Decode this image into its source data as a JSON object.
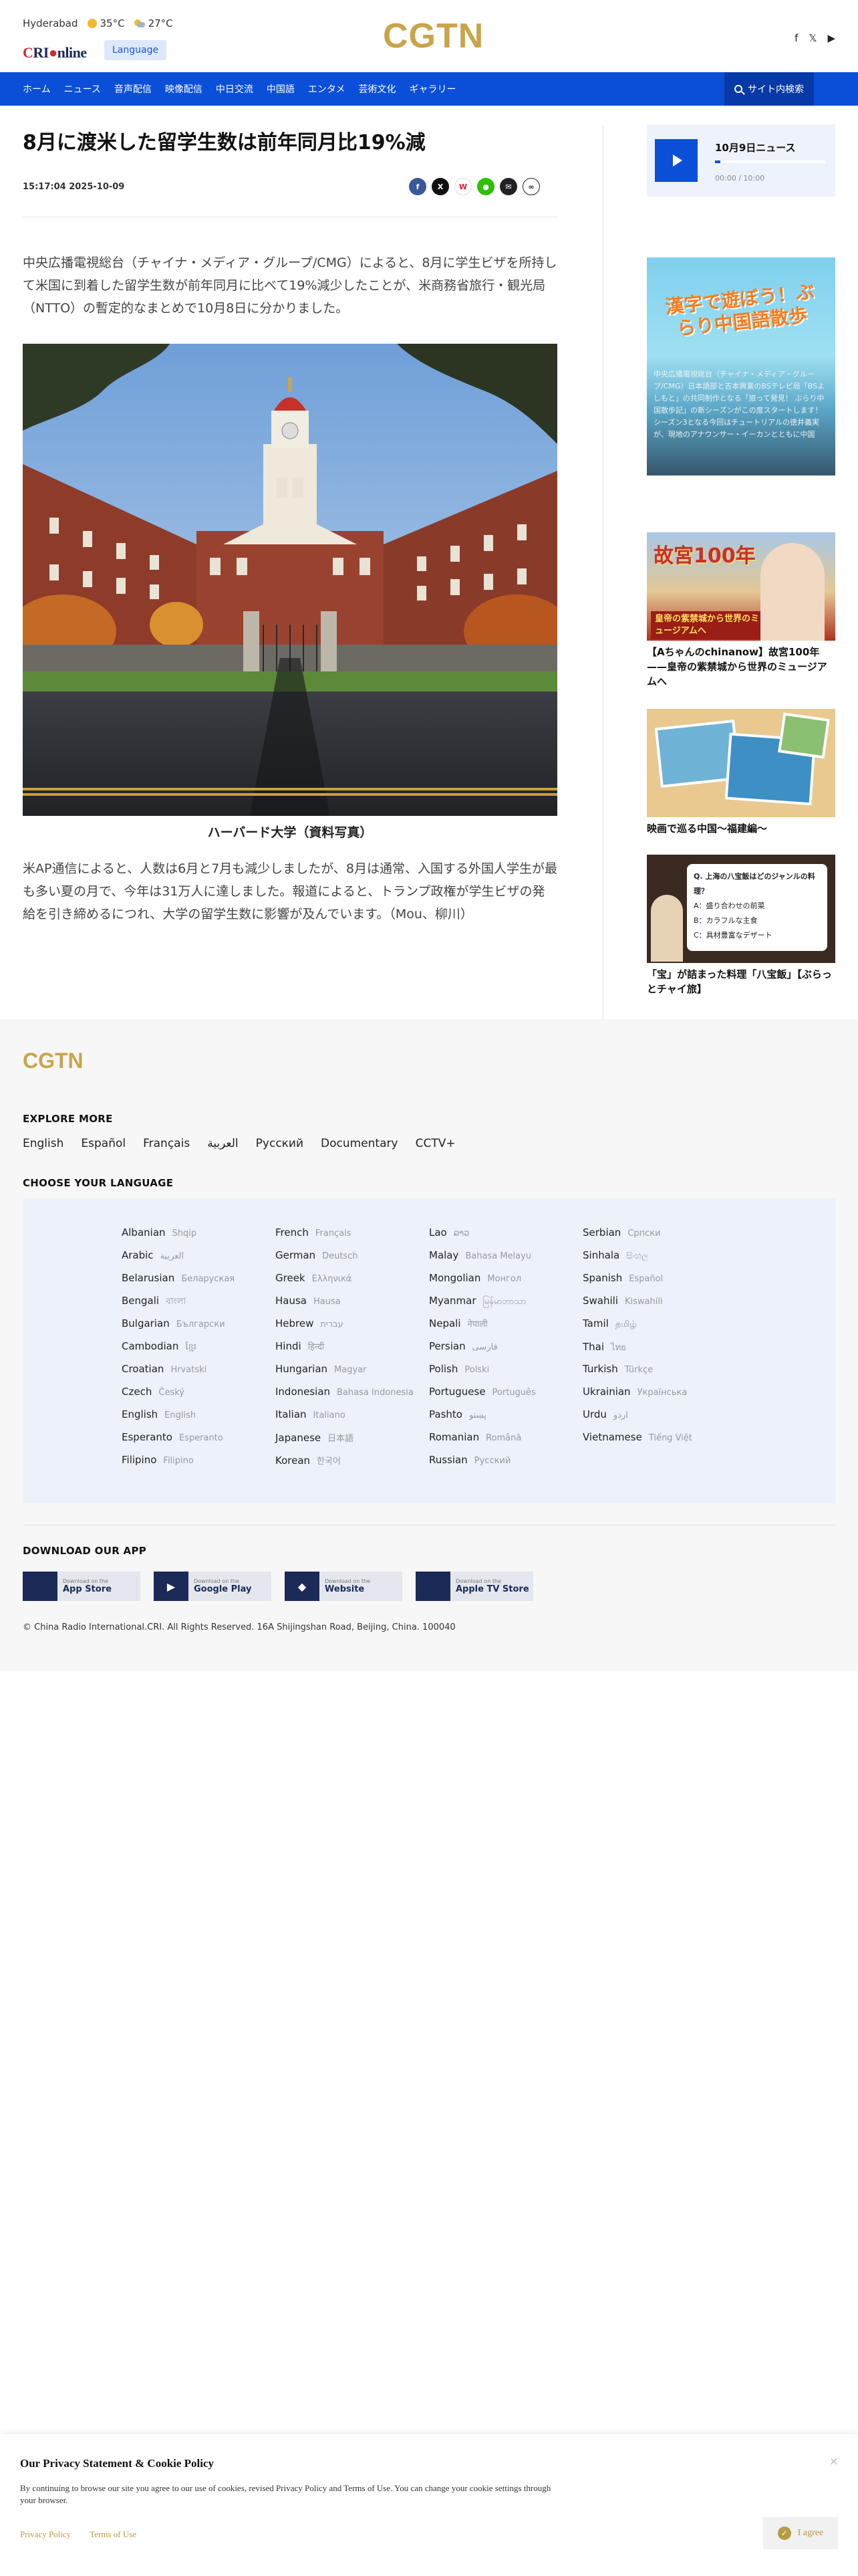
{
  "header": {
    "city": "Hyderabad",
    "temp_high": "35°C",
    "temp_low": "27°C",
    "site_logo": "CRI online",
    "language_button": "Language",
    "brand": "CGTN",
    "social_icons": [
      "facebook-icon",
      "x-icon",
      "youtube-icon"
    ]
  },
  "nav": {
    "items": [
      "ホーム",
      "ニュース",
      "音声配信",
      "映像配信",
      "中日交流",
      "中国語",
      "エンタメ",
      "芸術文化",
      "ギャラリー"
    ],
    "search_label": "サイト内検索"
  },
  "article": {
    "title": "8月に渡米した留学生数は前年同月比19%減",
    "datetime": "15:17:04 2025-10-09",
    "share_icons": [
      "facebook",
      "x",
      "weibo",
      "wechat",
      "email",
      "link"
    ],
    "para1": "中央広播電視総台（チャイナ・メディア・グループ/CMG）によると、8月に学生ビザを所持して米国に到着した留学生数が前年同月に比べて19%減少したことが、米商務省旅行・観光局（NTTO）の暫定的なまとめで10月8日に分かりました。",
    "image_caption": "ハーバード大学（資料写真）",
    "para2": "米AP通信によると、人数は6月と7月も減少しましたが、8月は通常、入国する外国人学生が最も多い夏の月で、今年は31万人に達しました。報道によると、トランプ政権が学生ビザの発給を引き締めるにつれ、大学の留学生数に影響が及んでいます。（Mou、柳川）"
  },
  "sidebar": {
    "audio": {
      "title": "10月9日ニュース",
      "time": "00:00 / 10:00",
      "progress": 0.05
    },
    "promo": {
      "heading": "漢字で遊ぼう！ぶらり中国語散歩",
      "text": "中央広播電視総台（チャイナ・メディア・グループ/CMG）日本語部と吉本興業のBSテレビ局「BSよしもと」の共同制作となる「旅って発見！ ぶらり中国散歩記」の新シーズンがこの度スタートします！ シーズン3となる今回はチュートリアルの徳井義実が、現地のアナウンサー・イーカンとともに中国"
    },
    "cards": [
      {
        "title": "【Aちゃんのchinanow】故宮100年——皇帝の紫禁城から世界のミュージアムへ",
        "img_text": "故宮100年",
        "img_sub": "皇帝の紫禁城から世界のミュージアムへ"
      },
      {
        "title": "映画で巡る中国〜福建編〜"
      },
      {
        "title": "「宝」が詰まった料理「八宝飯」【ぶらっとチャイ旅】",
        "quiz": [
          "Q. 上海の八宝飯はどのジャンルの料理？",
          "A：盛り合わせの前菜",
          "B：カラフルな主食",
          "C：具材豊富なデザート"
        ]
      }
    ]
  },
  "footer": {
    "logo": "CGTN",
    "explore_heading": "EXPLORE MORE",
    "explore_links": [
      "English",
      "Español",
      "Français",
      "العربية",
      "Русский",
      "Documentary",
      "CCTV+"
    ],
    "language_heading": "CHOOSE YOUR LANGUAGE",
    "languages": [
      [
        [
          "Albanian",
          "Shqip"
        ],
        [
          "Arabic",
          "العربية"
        ],
        [
          "Belarusian",
          "Беларуская"
        ],
        [
          "Bengali",
          "বাংলা"
        ],
        [
          "Bulgarian",
          "Български"
        ],
        [
          "Cambodian",
          "ខ្មែរ"
        ],
        [
          "Croatian",
          "Hrvatski"
        ],
        [
          "Czech",
          "Český"
        ],
        [
          "English",
          "English"
        ],
        [
          "Esperanto",
          "Esperanto"
        ],
        [
          "Filipino",
          "Filipino"
        ]
      ],
      [
        [
          "French",
          "Français"
        ],
        [
          "German",
          "Deutsch"
        ],
        [
          "Greek",
          "Ελληνικά"
        ],
        [
          "Hausa",
          "Hausa"
        ],
        [
          "Hebrew",
          "עברית"
        ],
        [
          "Hindi",
          "हिन्दी"
        ],
        [
          "Hungarian",
          "Magyar"
        ],
        [
          "Indonesian",
          "Bahasa Indonesia"
        ],
        [
          "Italian",
          "Italiano"
        ],
        [
          "Japanese",
          "日本語"
        ],
        [
          "Korean",
          "한국어"
        ]
      ],
      [
        [
          "Lao",
          "ລາວ"
        ],
        [
          "Malay",
          "Bahasa Melayu"
        ],
        [
          "Mongolian",
          "Монгол"
        ],
        [
          "Myanmar",
          "မြန်မာဘာသာ"
        ],
        [
          "Nepali",
          "नेपाली"
        ],
        [
          "Persian",
          "فارسی"
        ],
        [
          "Polish",
          "Polski"
        ],
        [
          "Portuguese",
          "Português"
        ],
        [
          "Pashto",
          "پښتو"
        ],
        [
          "Romanian",
          "Română"
        ],
        [
          "Russian",
          "Русский"
        ]
      ],
      [
        [
          "Serbian",
          "Српски"
        ],
        [
          "Sinhala",
          "සිංහල"
        ],
        [
          "Spanish",
          "Español"
        ],
        [
          "Swahili",
          "Kiswahili"
        ],
        [
          "Tamil",
          "தமிழ்"
        ],
        [
          "Thai",
          "ไทย"
        ],
        [
          "Turkish",
          "Türkçe"
        ],
        [
          "Ukrainian",
          "Українська"
        ],
        [
          "Urdu",
          "اردو"
        ],
        [
          "Vietnamese",
          "Tiếng Việt"
        ]
      ]
    ],
    "download_heading": "DOWNLOAD OUR APP",
    "apps": [
      {
        "small": "Download on the",
        "name": "App Store",
        "icon": "apple-icon"
      },
      {
        "small": "Download on the",
        "name": "Google Play",
        "icon": "play-icon"
      },
      {
        "small": "Download on the",
        "name": "Website",
        "icon": "android-icon"
      },
      {
        "small": "Download on the",
        "name": "Apple TV Store",
        "icon": "apple-icon"
      }
    ],
    "copyright": "© China Radio International.CRI. All Rights Reserved. 16A Shijingshan Road, Beijing, China. 100040"
  },
  "cookie": {
    "title": "Our Privacy Statement & Cookie Policy",
    "text": "By continuing to browse our site you agree to our use of cookies, revised Privacy Policy and Terms of Use. You can change your cookie settings through your browser.",
    "privacy_link": "Privacy Policy",
    "terms_link": "Terms of Use",
    "agree": "I agree",
    "close": "×"
  }
}
